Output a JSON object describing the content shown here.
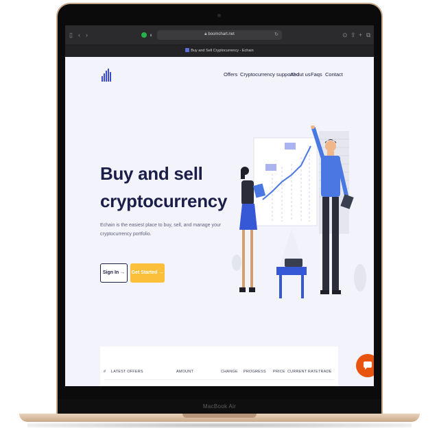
{
  "device": {
    "label": "MacBook Air"
  },
  "browser": {
    "url": "boomchart.net",
    "tab_title": "Buy and Sell Cryptocurrency - Echain"
  },
  "nav": {
    "items": [
      {
        "label": "Offers"
      },
      {
        "label": "Cryptocurrency supported"
      },
      {
        "label": "About us"
      },
      {
        "label": "Faqs"
      },
      {
        "label": "Contact"
      }
    ]
  },
  "hero": {
    "title": "Buy and sell cryptocurrency",
    "description": "Echain is the easiest place to buy, sell, and manage your cryptocurrency portfolio.",
    "signin_label": "Sign In",
    "start_label": "Get Started",
    "arrow": "→"
  },
  "offers_table": {
    "headers": [
      "#",
      "LATEST OFFERS",
      "AMOUNT",
      "CHANGE",
      "PROGRESS",
      "PRICE",
      "CURRENT RATE",
      "TRADE"
    ]
  },
  "colors": {
    "brand": "#3d4ccf",
    "accent": "#fbbf3a",
    "heading": "#1c1e4a",
    "chat": "#e8540f"
  },
  "icons": [
    "sidebar-icon",
    "back-icon",
    "forward-icon",
    "lock-icon",
    "reload-icon",
    "download-icon",
    "share-icon",
    "new-tab-icon",
    "tabs-icon",
    "chat-icon",
    "arrow-right-icon"
  ]
}
